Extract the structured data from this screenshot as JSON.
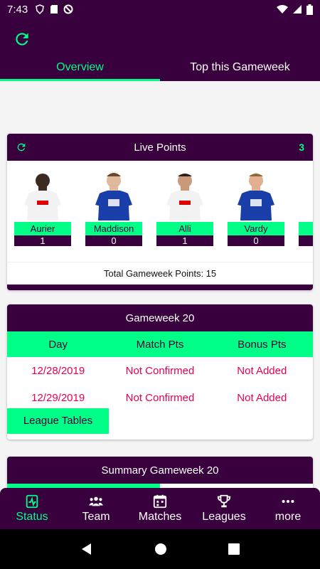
{
  "status_bar": {
    "time": "7:43"
  },
  "tabs": [
    {
      "label": "Overview",
      "active": true
    },
    {
      "label": "Top this Gameweek",
      "active": false
    }
  ],
  "live_points": {
    "title": "Live Points",
    "count": "3",
    "players": [
      {
        "name": "Aurier",
        "points": "1",
        "kit": "white"
      },
      {
        "name": "Maddison",
        "points": "0",
        "kit": "blue"
      },
      {
        "name": "Alli",
        "points": "1",
        "kit": "white"
      },
      {
        "name": "Vardy",
        "points": "0",
        "kit": "blue"
      }
    ],
    "total_label": "Total Gameweek Points: 15"
  },
  "gameweek": {
    "title": "Gameweek 20",
    "columns": [
      "Day",
      "Match Pts",
      "Bonus Pts"
    ],
    "rows": [
      [
        "12/28/2019",
        "Not Confirmed",
        "Not Added"
      ],
      [
        "12/29/2019",
        "Not Confirmed",
        "Not Added"
      ]
    ],
    "league_button": "League Tables"
  },
  "summary": {
    "title": "Summary Gameweek 20"
  },
  "bottom_nav": [
    {
      "label": "Status",
      "icon": "status-icon",
      "active": true
    },
    {
      "label": "Team",
      "icon": "team-icon",
      "active": false
    },
    {
      "label": "Matches",
      "icon": "calendar-icon",
      "active": false
    },
    {
      "label": "Leagues",
      "icon": "trophy-icon",
      "active": false
    },
    {
      "label": "more",
      "icon": "more-icon",
      "active": false
    }
  ],
  "colors": {
    "primary": "#38003c",
    "accent": "#00ff87",
    "alert": "#e90052"
  }
}
